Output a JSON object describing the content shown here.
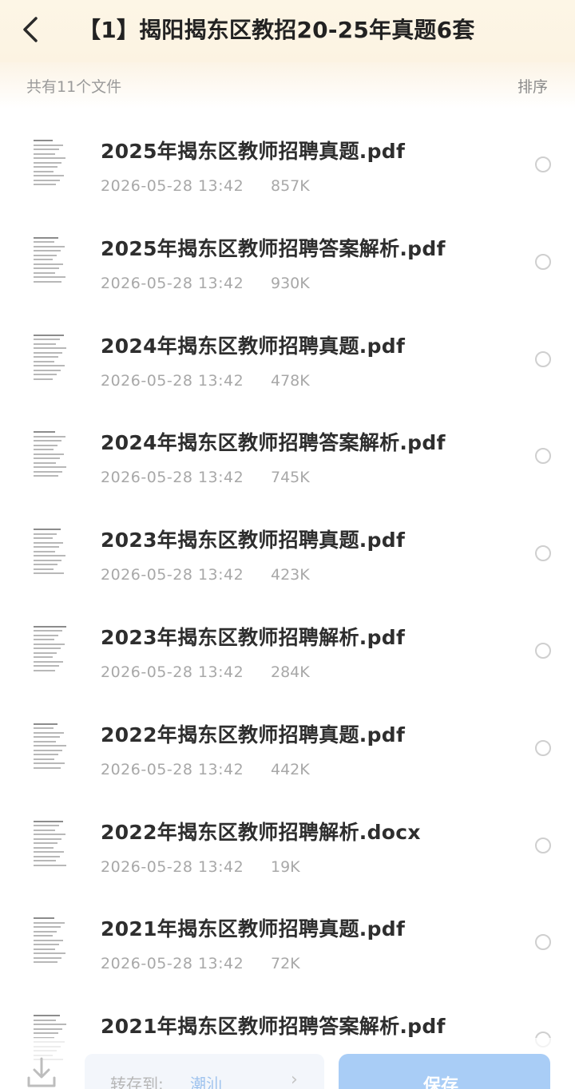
{
  "header": {
    "title": "【1】揭阳揭东区教招20-25年真题6套"
  },
  "subbar": {
    "file_count": "共有11个文件",
    "sort_label": "排序"
  },
  "files": [
    {
      "name": "2025年揭东区教师招聘真题.pdf",
      "date": "2026-05-28 13:42",
      "size": "857K"
    },
    {
      "name": "2025年揭东区教师招聘答案解析.pdf",
      "date": "2026-05-28 13:42",
      "size": "930K"
    },
    {
      "name": "2024年揭东区教师招聘真题.pdf",
      "date": "2026-05-28 13:42",
      "size": "478K"
    },
    {
      "name": "2024年揭东区教师招聘答案解析.pdf",
      "date": "2026-05-28 13:42",
      "size": "745K"
    },
    {
      "name": "2023年揭东区教师招聘真题.pdf",
      "date": "2026-05-28 13:42",
      "size": "423K"
    },
    {
      "name": "2023年揭东区教师招聘解析.pdf",
      "date": "2026-05-28 13:42",
      "size": "284K"
    },
    {
      "name": "2022年揭东区教师招聘真题.pdf",
      "date": "2026-05-28 13:42",
      "size": "442K"
    },
    {
      "name": "2022年揭东区教师招聘解析.docx",
      "date": "2026-05-28 13:42",
      "size": "19K"
    },
    {
      "name": "2021年揭东区教师招聘真题.pdf",
      "date": "2026-05-28 13:42",
      "size": "72K"
    },
    {
      "name": "2021年揭东区教师招聘答案解析.pdf",
      "date": "",
      "size": ""
    }
  ],
  "bottom_bar": {
    "save_to_label": "转存到:",
    "save_to_target": "潮汕",
    "save_label": "保存"
  },
  "icons": {
    "back": "chevron-left-icon",
    "download": "download-icon",
    "forward": "chevron-right-icon"
  },
  "colors": {
    "header_bg": "#fdf6e6",
    "save_button": "#a9cdf6",
    "save_to_target": "#9fc3ee"
  }
}
